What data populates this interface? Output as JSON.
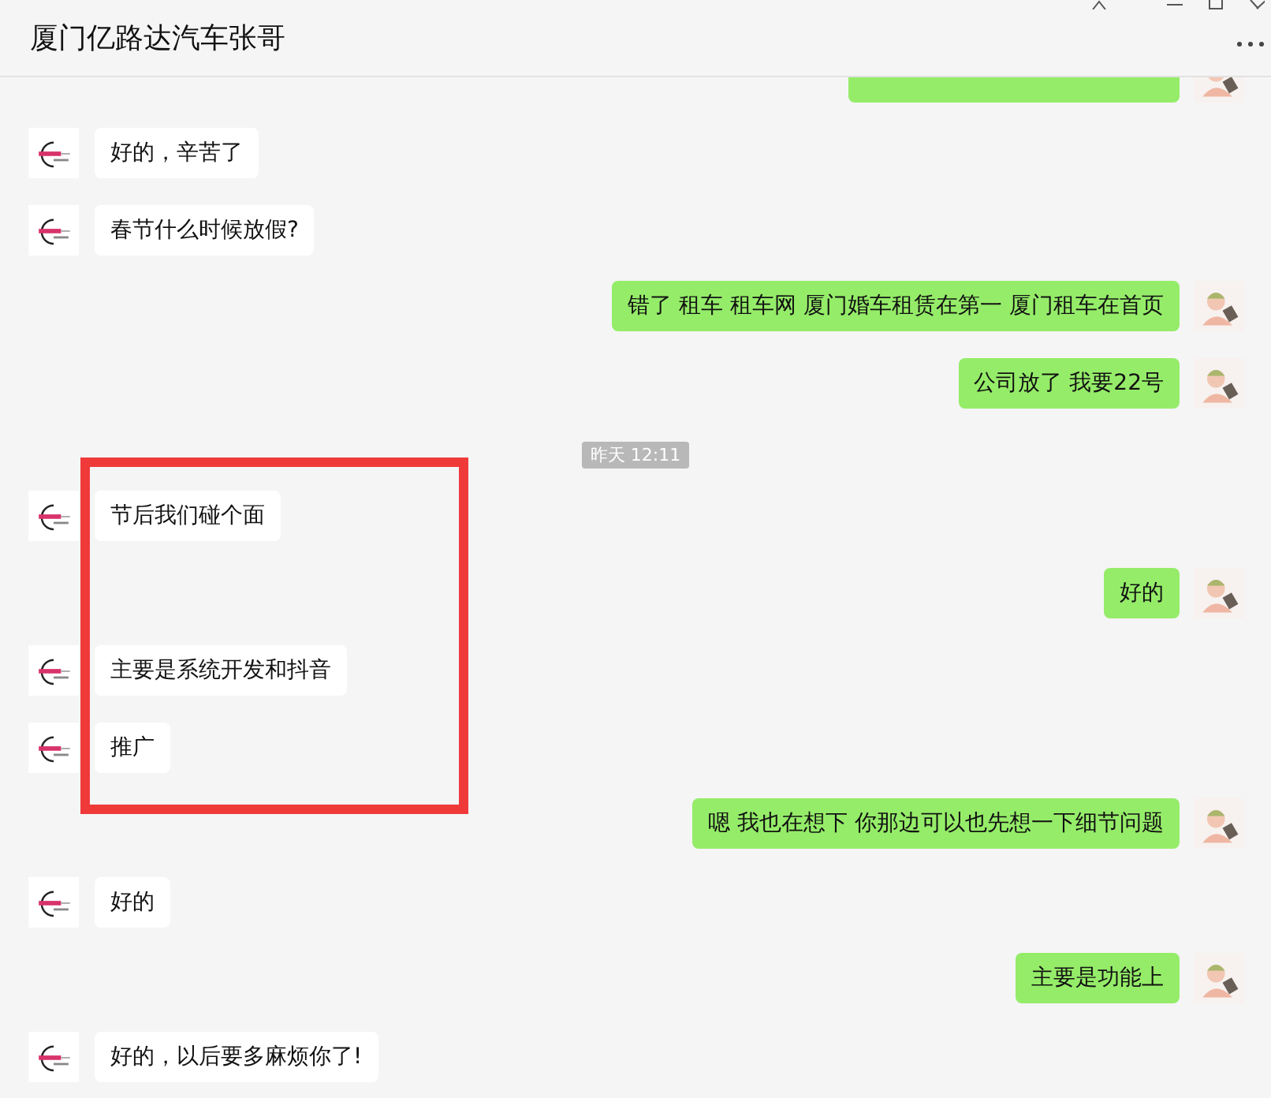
{
  "window": {
    "title": "厦门亿路达汽车张哥"
  },
  "messages": [
    {
      "kind": "clipped",
      "mine": true
    },
    {
      "kind": "text",
      "mine": false,
      "text": "好的，辛苦了"
    },
    {
      "kind": "text",
      "mine": false,
      "text": "春节什么时候放假?"
    },
    {
      "kind": "text",
      "mine": true,
      "text": "错了 租车  租车网 厦门婚车租赁在第一  厦门租车在首页"
    },
    {
      "kind": "text",
      "mine": true,
      "text": "公司放了 我要22号"
    },
    {
      "kind": "time",
      "text": "昨天 12:11"
    },
    {
      "kind": "text",
      "mine": false,
      "text": "节后我们碰个面"
    },
    {
      "kind": "text",
      "mine": true,
      "text": "好的"
    },
    {
      "kind": "text",
      "mine": false,
      "text": "主要是系统开发和抖音"
    },
    {
      "kind": "text",
      "mine": false,
      "text": "推广"
    },
    {
      "kind": "text",
      "mine": true,
      "text": "嗯 我也在想下 你那边可以也先想一下细节问题"
    },
    {
      "kind": "text",
      "mine": false,
      "text": "好的"
    },
    {
      "kind": "text",
      "mine": true,
      "text": "主要是功能上"
    },
    {
      "kind": "text",
      "mine": false,
      "text": "好的，以后要多麻烦你了!"
    }
  ]
}
